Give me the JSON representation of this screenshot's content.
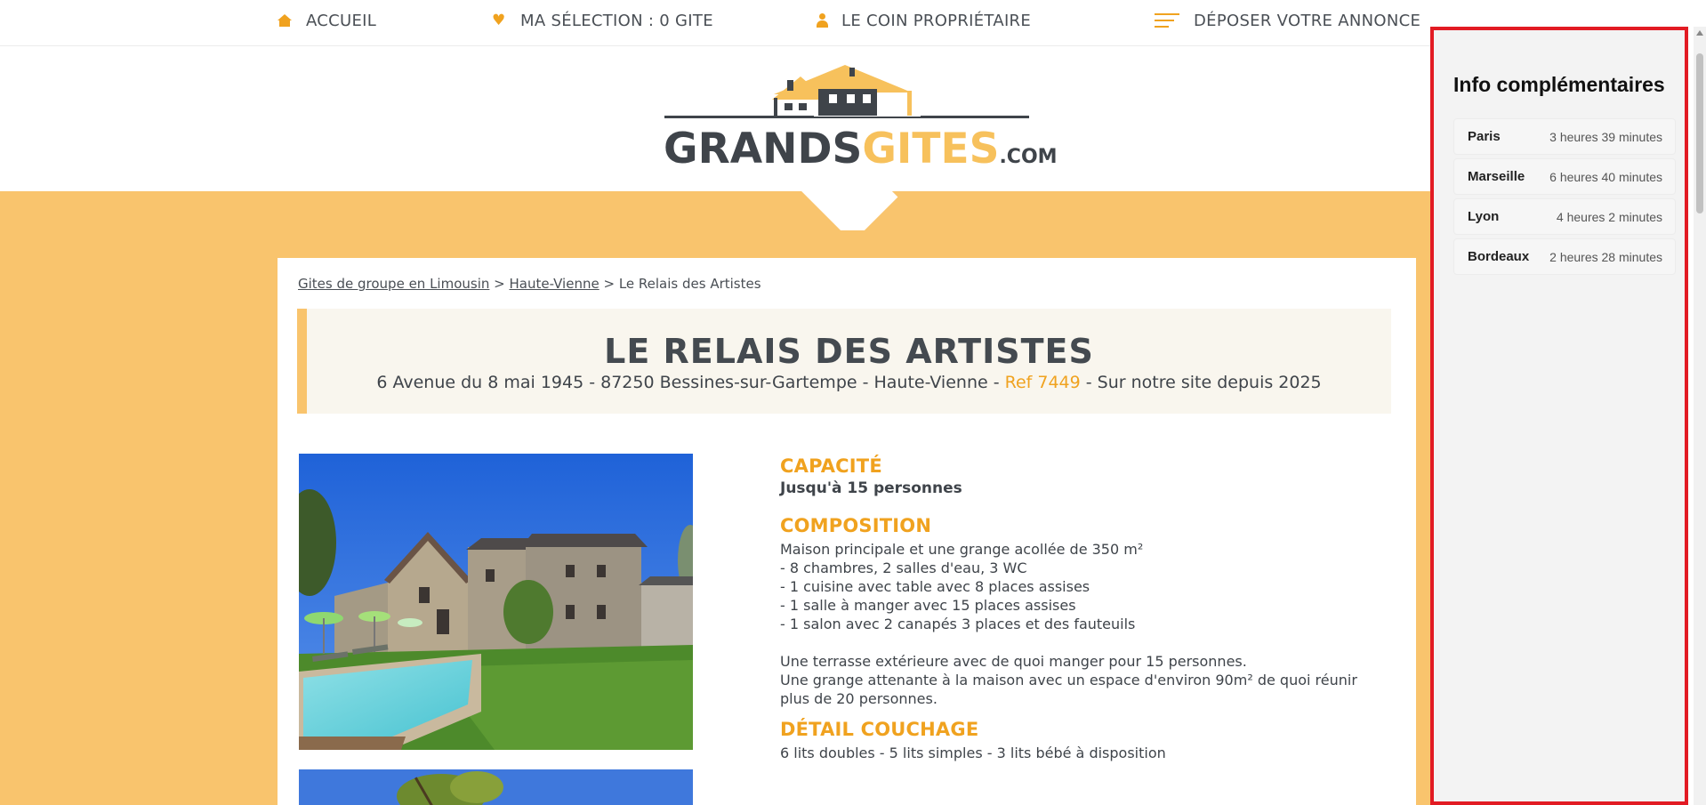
{
  "nav": {
    "items": [
      {
        "label": "ACCUEIL",
        "icon": "home-icon"
      },
      {
        "label": "MA SÉLECTION : 0 GITE",
        "icon": "heart-icon"
      },
      {
        "label": "LE COIN PROPRIÉTAIRE",
        "icon": "user-icon"
      },
      {
        "label": "DÉPOSER VOTRE ANNONCE",
        "icon": "menu-icon"
      }
    ]
  },
  "logo": {
    "part1": "GRANDS",
    "part2": "GITES",
    "part3": ".COM"
  },
  "breadcrumb": {
    "link1": "Gites de groupe en Limousin",
    "sep1": " > ",
    "link2": "Haute-Vienne",
    "sep2": " > ",
    "current": "Le Relais des Artistes"
  },
  "listing": {
    "title": "LE RELAIS DES ARTISTES",
    "address": "6 Avenue du 8 mai 1945 - 87250 Bessines-sur-Gartempe - Haute-Vienne - ",
    "ref": "Ref 7449",
    "since": " - Sur notre site depuis 2025"
  },
  "details": {
    "capacity_title": "CAPACITÉ",
    "capacity_text": "Jusqu'à 15 personnes",
    "composition_title": "COMPOSITION",
    "composition_lines": [
      "Maison principale et une grange acollée de 350 m²",
      "- 8 chambres, 2 salles d'eau, 3 WC",
      "- 1 cuisine avec table avec 8 places assises",
      "- 1 salle à manger avec 15 places assises",
      "- 1 salon avec 2 canapés 3 places et des fauteuils"
    ],
    "terrace_line1": "Une terrasse extérieure avec de quoi manger pour 15 personnes.",
    "terrace_line2": "Une grange attenante à la maison avec un espace d'environ 90m² de quoi réunir",
    "terrace_line3": "plus de 20 personnes.",
    "couchage_title": "DÉTAIL COUCHAGE",
    "couchage_text": "6 lits doubles - 5 lits simples - 3 lits bébé à disposition"
  },
  "sidepanel": {
    "title": "Info complémentaires",
    "rows": [
      {
        "city": "Paris",
        "time": "3 heures 39 minutes"
      },
      {
        "city": "Marseille",
        "time": "6 heures 40 minutes"
      },
      {
        "city": "Lyon",
        "time": "4 heures 2 minutes"
      },
      {
        "city": "Bordeaux",
        "time": "2 heures 28 minutes"
      }
    ]
  },
  "colors": {
    "accent": "#f0a21f",
    "band": "#f9c46d",
    "panel_border": "#e21b23"
  }
}
